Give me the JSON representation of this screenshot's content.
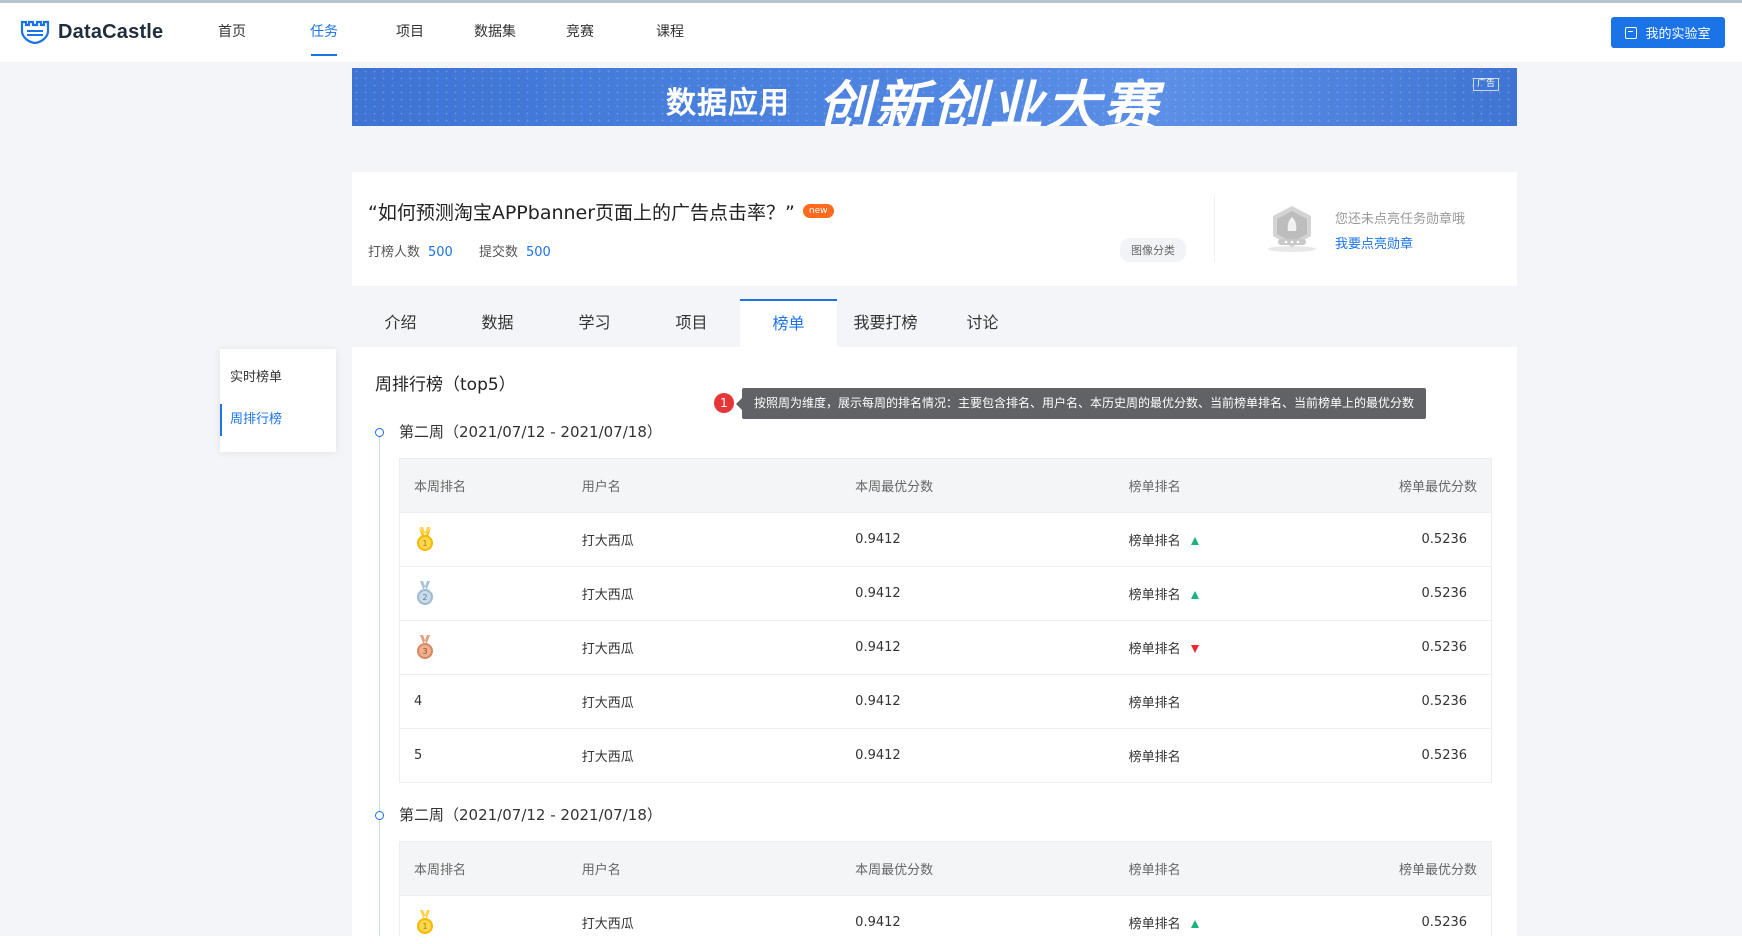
{
  "header": {
    "logo_text": "DataCastle",
    "nav": [
      {
        "label": "首页",
        "active": false
      },
      {
        "label": "任务",
        "active": true
      },
      {
        "label": "项目",
        "active": false
      },
      {
        "label": "数据集",
        "active": false
      },
      {
        "label": "竞赛",
        "active": false
      },
      {
        "label": "课程",
        "active": false
      }
    ],
    "lab_button": "我的实验室"
  },
  "banner": {
    "line1": "数据应用",
    "line2": "创新创业大赛",
    "ad_label": "广告"
  },
  "task": {
    "title": "“如何预测淘宝APPbanner页面上的广告点击率？”",
    "new_badge": "new",
    "participants_label": "打榜人数",
    "participants_value": "500",
    "submissions_label": "提交数",
    "submissions_value": "500",
    "tag": "图像分类",
    "medal_hint": "您还未点亮任务勋章哦",
    "medal_link": "我要点亮勋章"
  },
  "tabs": [
    {
      "label": "介绍",
      "active": false
    },
    {
      "label": "数据",
      "active": false
    },
    {
      "label": "学习",
      "active": false
    },
    {
      "label": "项目",
      "active": false
    },
    {
      "label": "榜单",
      "active": true
    },
    {
      "label": "我要打榜",
      "active": false
    },
    {
      "label": "讨论",
      "active": false
    }
  ],
  "side_menu": [
    {
      "label": "实时榜单",
      "active": false
    },
    {
      "label": "周排行榜",
      "active": true
    }
  ],
  "leaderboard": {
    "section_title": "周排行榜（top5）",
    "columns": [
      "本周排名",
      "用户名",
      "本周最优分数",
      "榜单排名",
      "榜单最优分数"
    ],
    "weeks": [
      {
        "title": "第二周（2021/07/12 - 2021/07/18）",
        "rows": [
          {
            "rank": "1",
            "medal": "gold",
            "user": "打大西瓜",
            "week_score": "0.9412",
            "board_rank": "榜单排名",
            "trend": "up",
            "board_score": "0.5236"
          },
          {
            "rank": "2",
            "medal": "silver",
            "user": "打大西瓜",
            "week_score": "0.9412",
            "board_rank": "榜单排名",
            "trend": "up",
            "board_score": "0.5236"
          },
          {
            "rank": "3",
            "medal": "bronze",
            "user": "打大西瓜",
            "week_score": "0.9412",
            "board_rank": "榜单排名",
            "trend": "down",
            "board_score": "0.5236"
          },
          {
            "rank": "4",
            "medal": "",
            "user": "打大西瓜",
            "week_score": "0.9412",
            "board_rank": "榜单排名",
            "trend": "",
            "board_score": "0.5236"
          },
          {
            "rank": "5",
            "medal": "",
            "user": "打大西瓜",
            "week_score": "0.9412",
            "board_rank": "榜单排名",
            "trend": "",
            "board_score": "0.5236"
          }
        ]
      },
      {
        "title": "第二周（2021/07/12 - 2021/07/18）",
        "rows": [
          {
            "rank": "1",
            "medal": "gold",
            "user": "打大西瓜",
            "week_score": "0.9412",
            "board_rank": "榜单排名",
            "trend": "up",
            "board_score": "0.5236"
          }
        ]
      }
    ]
  },
  "annotation": {
    "number": "1",
    "text": "按照周为维度，展示每周的排名情况：主要包含排名、用户名、本历史周的最优分数、当前榜单排名、当前榜单上的最优分数"
  },
  "colors": {
    "primary": "#1b73e8",
    "trend_up": "#19b37a",
    "trend_down": "#f5222d",
    "new_badge": "#ff6a1f",
    "annotation_bg": "#606266",
    "annotation_num": "#e63636"
  }
}
